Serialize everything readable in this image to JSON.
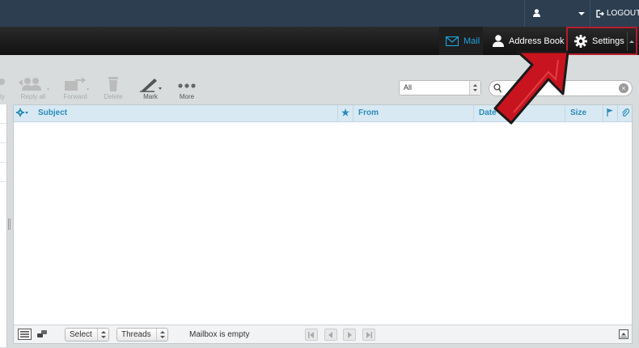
{
  "header": {
    "logout_label": "LOGOUT"
  },
  "taskbar": {
    "mail_label": "Mail",
    "addressbook_label": "Address Book",
    "settings_label": "Settings"
  },
  "toolbar": {
    "reply_label": "ly",
    "reply_all_label": "Reply all",
    "forward_label": "Forward",
    "delete_label": "Delete",
    "mark_label": "Mark",
    "more_label": "More",
    "filter_value": "All"
  },
  "list": {
    "columns": [
      "Subject",
      "From",
      "Date",
      "Size"
    ]
  },
  "footer": {
    "select_label": "Select",
    "threads_label": "Threads",
    "status_text": "Mailbox is empty"
  },
  "icons": [
    "user-icon",
    "logout-icon",
    "mail-icon",
    "addressbook-icon",
    "gear-icon",
    "search-icon",
    "flag-icon",
    "attachment-icon",
    "star-icon"
  ],
  "colors": {
    "topbar": "#2c3e50",
    "accent": "#1fa3e0",
    "highlight": "#b71c2c",
    "arrow": "#c8141e"
  }
}
